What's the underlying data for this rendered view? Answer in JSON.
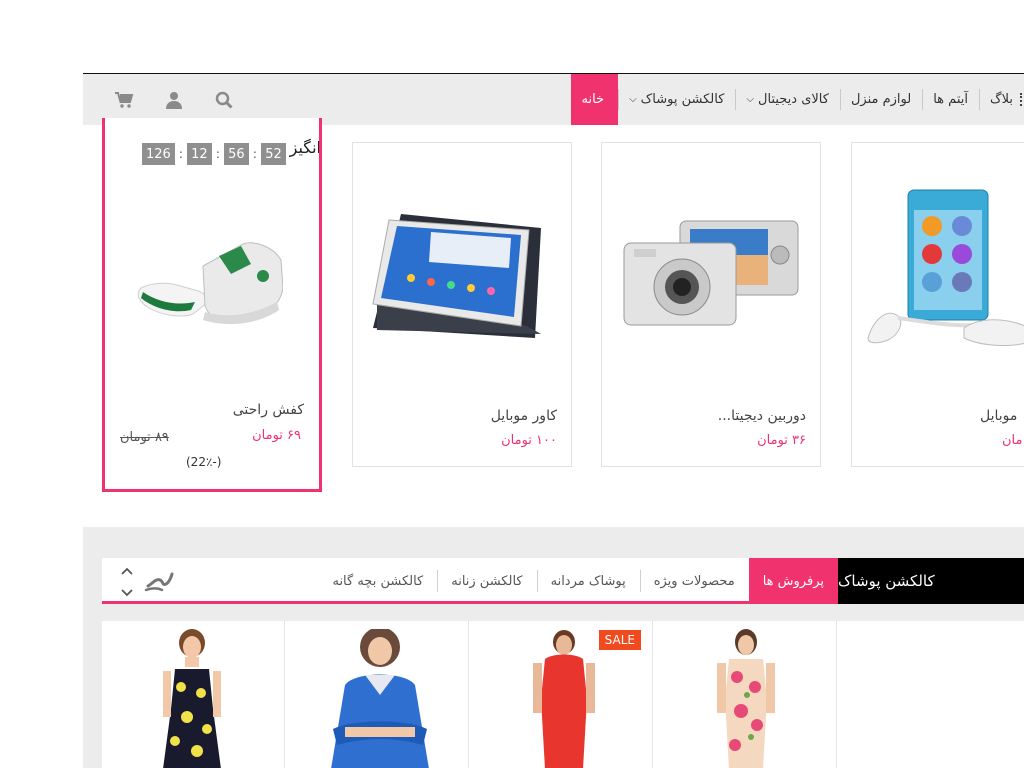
{
  "nav": {
    "items": [
      {
        "label": "خانه",
        "active": true,
        "dropdown": false
      },
      {
        "label": "کالکشن پوشاک",
        "active": false,
        "dropdown": true
      },
      {
        "label": "کالای دیجیتال",
        "active": false,
        "dropdown": true
      },
      {
        "label": "لوازم منزل",
        "active": false,
        "dropdown": false
      },
      {
        "label": "آیتم ها",
        "active": false,
        "dropdown": false
      },
      {
        "label": "بلاگ",
        "active": false,
        "dropdown": false
      }
    ],
    "icons": [
      "search-icon",
      "user-icon",
      "cart-icon"
    ]
  },
  "special_offer": {
    "title": "انگیز",
    "timer": [
      "126",
      "12",
      "56",
      "52"
    ],
    "name": "کفش راحتی",
    "price": "۶۹ تومان",
    "old_price": "۸۹ تومان",
    "discount": "(22٪-)"
  },
  "carousel": [
    {
      "name": "کاور موبایل",
      "price": "۱۰۰ تومان"
    },
    {
      "name": "دوربین دیجیتا...",
      "price": "۳۶ تومان"
    },
    {
      "name": "موبایل",
      "price": "مان"
    }
  ],
  "collection": {
    "title": "کالکشن پوشاک",
    "tabs": [
      "پرفروش ها",
      "محصولات ویژه",
      "پوشاک مردانه",
      "کالکشن زنانه",
      "کالکشن بچه گانه"
    ],
    "active_tab": 0,
    "sale_badge": "SALE"
  },
  "colors": {
    "accent": "#f0336f",
    "nav_bg": "#ececec",
    "sale": "#f04a1e"
  }
}
